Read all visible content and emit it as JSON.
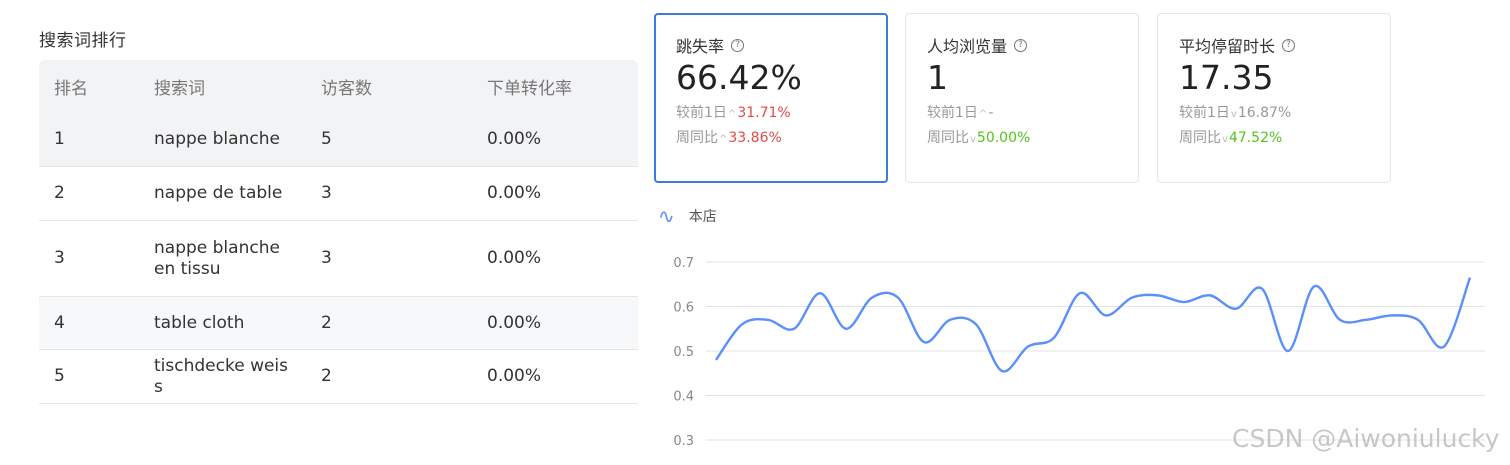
{
  "ranking": {
    "title": "搜索词排行",
    "headers": [
      "排名",
      "搜索词",
      "访客数",
      "下单转化率"
    ],
    "rows": [
      {
        "rank": "1",
        "word": "nappe blanche",
        "visitors": "5",
        "rate": "0.00%"
      },
      {
        "rank": "2",
        "word": "nappe de table",
        "visitors": "3",
        "rate": "0.00%"
      },
      {
        "rank": "3",
        "word": "nappe blanche en tissu",
        "visitors": "3",
        "rate": "0.00%"
      },
      {
        "rank": "4",
        "word": "table cloth",
        "visitors": "2",
        "rate": "0.00%"
      },
      {
        "rank": "5",
        "word": "tischdecke weiss",
        "visitors": "2",
        "rate": "0.00%"
      }
    ]
  },
  "cards": [
    {
      "title": "跳失率",
      "value": "66.42%",
      "day_label": "较前1日",
      "day_value": "31.71%",
      "week_label": "周同比",
      "week_value": "33.86%"
    },
    {
      "title": "人均浏览量",
      "value": "1",
      "day_label": "较前1日",
      "day_value": "-",
      "week_label": "周同比",
      "week_value": "50.00%"
    },
    {
      "title": "平均停留时长",
      "value": "17.35",
      "day_label": "较前1日",
      "day_value": "16.87%",
      "week_label": "周同比",
      "week_value": "47.52%"
    }
  ],
  "colors": {
    "accent": "#3a7cdd",
    "line": "#5b8ff9",
    "up": "#e34b4b",
    "down": "#52c41a"
  },
  "watermark": "CSDN @Aiwoniulucky",
  "chart_data": {
    "type": "line",
    "legend": "本店",
    "legend_placement": "top-left",
    "grid": true,
    "y_ticks": [
      "0.7",
      "0.6",
      "0.5",
      "0.4",
      "0.3"
    ],
    "ylim": [
      0.3,
      0.7
    ],
    "series": [
      {
        "name": "本店",
        "values": [
          0.48,
          0.56,
          0.57,
          0.55,
          0.63,
          0.55,
          0.62,
          0.62,
          0.52,
          0.57,
          0.56,
          0.455,
          0.51,
          0.53,
          0.63,
          0.58,
          0.62,
          0.625,
          0.61,
          0.625,
          0.595,
          0.64,
          0.5,
          0.645,
          0.57,
          0.57,
          0.58,
          0.57,
          0.51,
          0.665
        ]
      }
    ]
  }
}
